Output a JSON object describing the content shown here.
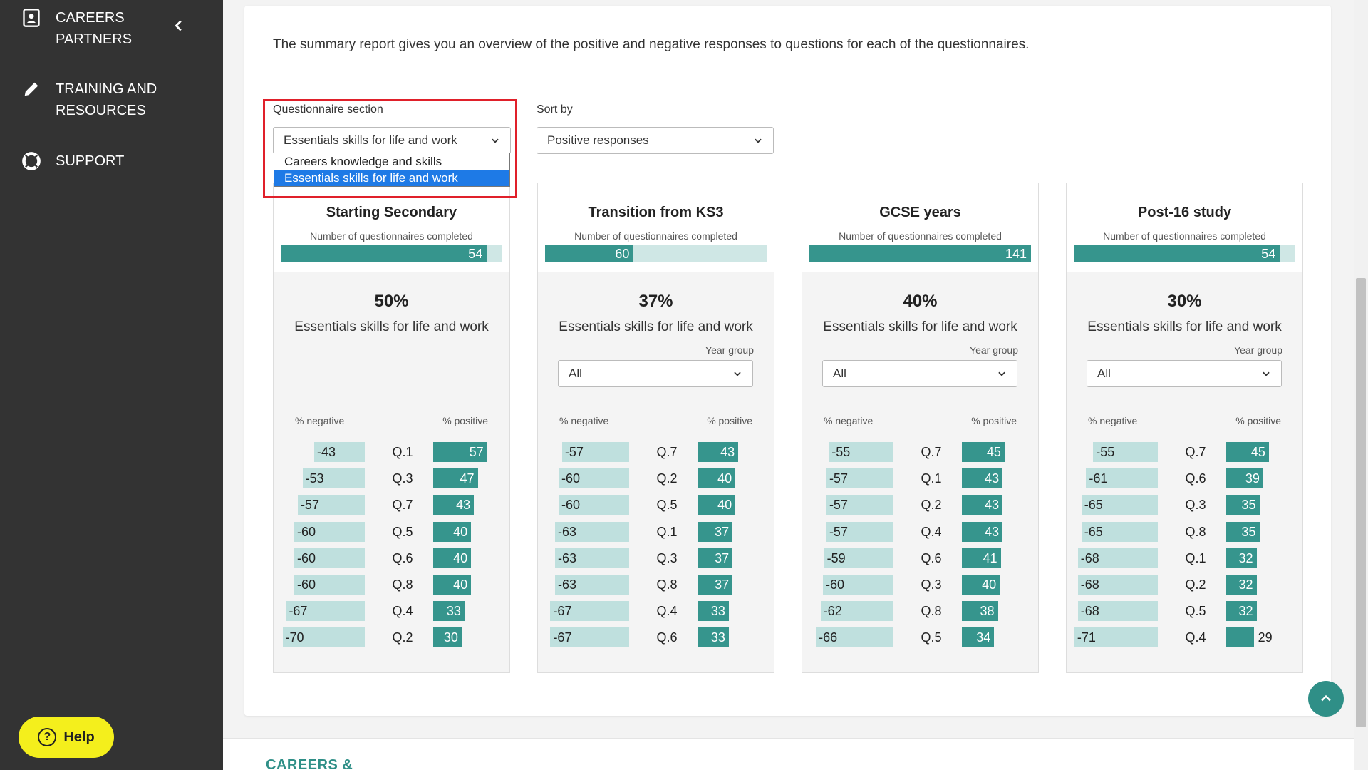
{
  "sidebar": {
    "items": [
      {
        "label": "CAREERS PARTNERS",
        "icon": "contact-card-icon"
      },
      {
        "label": "TRAINING AND RESOURCES",
        "icon": "pencil-icon"
      },
      {
        "label": "SUPPORT",
        "icon": "lifebuoy-icon"
      }
    ],
    "help_label": "Help"
  },
  "intro_text": "The summary report gives you an overview of the positive and negative responses to questions for each of the questionnaires.",
  "filters": {
    "section_label": "Questionnaire section",
    "section_value": "Essentials skills for life and work",
    "section_options": [
      "Careers knowledge and skills",
      "Essentials skills for life and work"
    ],
    "sort_label": "Sort by",
    "sort_value": "Positive responses"
  },
  "colors": {
    "accent": "#36958d",
    "negative": "#bfe0de",
    "highlight": "#e0202a"
  },
  "panels": [
    {
      "title": "Starting Secondary",
      "subtitle": "Number of questionnaires completed",
      "count": 54,
      "count_fraction": 0.93,
      "percent": "50%",
      "section_name": "Essentials skills for life and work",
      "has_year_group": false,
      "axis_negative": "% negative",
      "axis_positive": "% positive",
      "rows": [
        {
          "neg": -43,
          "q": "Q.1",
          "pos": 57
        },
        {
          "neg": -53,
          "q": "Q.3",
          "pos": 47
        },
        {
          "neg": -57,
          "q": "Q.7",
          "pos": 43
        },
        {
          "neg": -60,
          "q": "Q.5",
          "pos": 40
        },
        {
          "neg": -60,
          "q": "Q.6",
          "pos": 40
        },
        {
          "neg": -60,
          "q": "Q.8",
          "pos": 40
        },
        {
          "neg": -67,
          "q": "Q.4",
          "pos": 33
        },
        {
          "neg": -70,
          "q": "Q.2",
          "pos": 30
        }
      ]
    },
    {
      "title": "Transition from KS3",
      "subtitle": "Number of questionnaires completed",
      "count": 60,
      "count_fraction": 0.4,
      "percent": "37%",
      "section_name": "Essentials skills for life and work",
      "has_year_group": true,
      "year_group_label": "Year group",
      "year_group_value": "All",
      "axis_negative": "% negative",
      "axis_positive": "% positive",
      "rows": [
        {
          "neg": -57,
          "q": "Q.7",
          "pos": 43
        },
        {
          "neg": -60,
          "q": "Q.2",
          "pos": 40
        },
        {
          "neg": -60,
          "q": "Q.5",
          "pos": 40
        },
        {
          "neg": -63,
          "q": "Q.1",
          "pos": 37
        },
        {
          "neg": -63,
          "q": "Q.3",
          "pos": 37
        },
        {
          "neg": -63,
          "q": "Q.8",
          "pos": 37
        },
        {
          "neg": -67,
          "q": "Q.4",
          "pos": 33
        },
        {
          "neg": -67,
          "q": "Q.6",
          "pos": 33
        }
      ]
    },
    {
      "title": "GCSE years",
      "subtitle": "Number of questionnaires completed",
      "count": 141,
      "count_fraction": 1.0,
      "percent": "40%",
      "section_name": "Essentials skills for life and work",
      "has_year_group": true,
      "year_group_label": "Year group",
      "year_group_value": "All",
      "axis_negative": "% negative",
      "axis_positive": "% positive",
      "rows": [
        {
          "neg": -55,
          "q": "Q.7",
          "pos": 45
        },
        {
          "neg": -57,
          "q": "Q.1",
          "pos": 43
        },
        {
          "neg": -57,
          "q": "Q.2",
          "pos": 43
        },
        {
          "neg": -57,
          "q": "Q.4",
          "pos": 43
        },
        {
          "neg": -59,
          "q": "Q.6",
          "pos": 41
        },
        {
          "neg": -60,
          "q": "Q.3",
          "pos": 40
        },
        {
          "neg": -62,
          "q": "Q.8",
          "pos": 38
        },
        {
          "neg": -66,
          "q": "Q.5",
          "pos": 34
        }
      ]
    },
    {
      "title": "Post-16 study",
      "subtitle": "Number of questionnaires completed",
      "count": 54,
      "count_fraction": 0.93,
      "percent": "30%",
      "section_name": "Essentials skills for life and work",
      "has_year_group": true,
      "year_group_label": "Year group",
      "year_group_value": "All",
      "axis_negative": "% negative",
      "axis_positive": "% positive",
      "rows": [
        {
          "neg": -55,
          "q": "Q.7",
          "pos": 45
        },
        {
          "neg": -61,
          "q": "Q.6",
          "pos": 39
        },
        {
          "neg": -65,
          "q": "Q.3",
          "pos": 35
        },
        {
          "neg": -65,
          "q": "Q.8",
          "pos": 35
        },
        {
          "neg": -68,
          "q": "Q.1",
          "pos": 32
        },
        {
          "neg": -68,
          "q": "Q.2",
          "pos": 32
        },
        {
          "neg": -68,
          "q": "Q.5",
          "pos": 32
        },
        {
          "neg": -71,
          "q": "Q.4",
          "pos": 29
        }
      ]
    }
  ],
  "footer": {
    "logo_text": "CAREERS &"
  }
}
